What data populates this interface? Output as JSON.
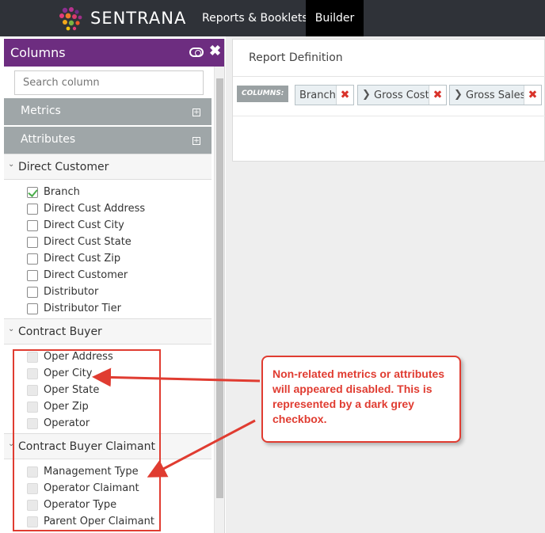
{
  "nav": {
    "brand": "SENTRANA",
    "links": [
      "Reports & Booklets",
      "Builder"
    ],
    "active_link": "Builder"
  },
  "columns_panel": {
    "title": "Columns",
    "search_placeholder": "Search column",
    "sections": [
      {
        "label": "Metrics",
        "icon": "plus-box-icon"
      },
      {
        "label": "Attributes",
        "icon": "plus-box-icon"
      }
    ],
    "groups": [
      {
        "label": "Direct Customer",
        "items": [
          {
            "label": "Branch",
            "state": "checked"
          },
          {
            "label": "Direct Cust Address",
            "state": "unchecked"
          },
          {
            "label": "Direct Cust City",
            "state": "unchecked"
          },
          {
            "label": "Direct Cust State",
            "state": "unchecked"
          },
          {
            "label": "Direct Cust Zip",
            "state": "unchecked"
          },
          {
            "label": "Direct Customer",
            "state": "unchecked"
          },
          {
            "label": "Distributor",
            "state": "unchecked"
          },
          {
            "label": "Distributor Tier",
            "state": "unchecked"
          }
        ]
      },
      {
        "label": "Contract Buyer",
        "items": [
          {
            "label": "Oper Address",
            "state": "disabled"
          },
          {
            "label": "Oper City",
            "state": "disabled"
          },
          {
            "label": "Oper State",
            "state": "disabled"
          },
          {
            "label": "Oper Zip",
            "state": "disabled"
          },
          {
            "label": "Operator",
            "state": "disabled"
          }
        ]
      },
      {
        "label": "Contract Buyer Claimant",
        "items": [
          {
            "label": "Management Type",
            "state": "disabled"
          },
          {
            "label": "Operator Claimant",
            "state": "disabled"
          },
          {
            "label": "Operator Type",
            "state": "disabled"
          },
          {
            "label": "Parent Oper Claimant",
            "state": "disabled"
          }
        ]
      }
    ]
  },
  "report_definition": {
    "title": "Report Definition",
    "columns_badge": "COLUMNS:",
    "chips": [
      {
        "label": "Branch",
        "expandable": false
      },
      {
        "label": "Gross Cost",
        "expandable": true
      },
      {
        "label": "Gross Sales",
        "expandable": true
      }
    ]
  },
  "annotation": {
    "text": "Non-related metrics or attributes will appeared disabled. This is represented by a dark grey checkbox.",
    "color": "#e03c31"
  },
  "colors": {
    "nav_bg": "#2f3238",
    "panel_header": "#6d2d80",
    "accordion": "#9fa6a8",
    "check_green": "#4cae4c",
    "remove_red": "#d9332b"
  }
}
